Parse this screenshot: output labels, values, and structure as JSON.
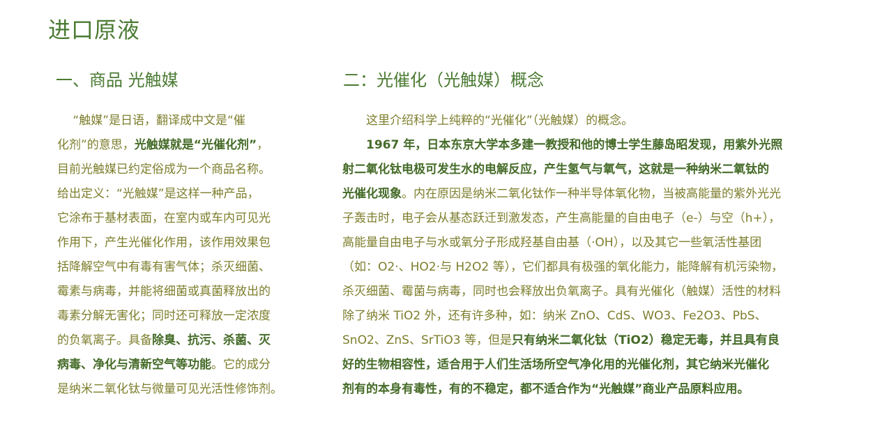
{
  "page_title": "进口原液",
  "section1": {
    "heading": "一、商品 光触媒",
    "lines": [
      [
        {
          "t": "　 “触媒”是日语，翻译成中文是“催"
        }
      ],
      [
        {
          "t": "化剂”的意思，"
        },
        {
          "t": "光触媒就是“光催化剂”",
          "b": true
        },
        {
          "t": "，"
        }
      ],
      [
        {
          "t": "目前光触媒已约定俗成为一个商品名称。"
        }
      ],
      [
        {
          "t": "给出定义：“光触媒”是这样一种产品，"
        }
      ],
      [
        {
          "t": "它涂布于基材表面，在室内或车内可见光"
        }
      ],
      [
        {
          "t": "作用下，产生光催化作用，该作用效果包"
        }
      ],
      [
        {
          "t": "括降解空气中有毒有害气体；杀灭细菌、"
        }
      ],
      [
        {
          "t": "霉素与病毒，并能将细菌或真菌释放出的"
        }
      ],
      [
        {
          "t": "毒素分解无害化；同时还可释放一定浓度"
        }
      ],
      [
        {
          "t": "的负氧离子。具备"
        },
        {
          "t": "除臭、抗污、杀菌、灭",
          "b": true
        }
      ],
      [
        {
          "t": "病毒、净化与清新空气等功能",
          "b": true
        },
        {
          "t": "。它的成分"
        }
      ],
      [
        {
          "t": "是纳米二氧化钛与微量可见光活性修饰剂。"
        }
      ]
    ]
  },
  "section2": {
    "heading": "二：光催化（光触媒）概念",
    "lines": [
      [
        {
          "t": "　　这里介绍科学上纯粹的“光催化”（光触媒）的概念。"
        }
      ],
      [
        {
          "t": "　　1967 年，日本东京大学本多建一教授和他的博士学生藤岛昭发现，用紫外光照",
          "b": true
        }
      ],
      [
        {
          "t": "射二氧化钛电极可发生水的电解反应，产生氢气与氧气，这就是一种纳米二氧钛的",
          "b": true
        }
      ],
      [
        {
          "t": "光催化现象",
          "b": true
        },
        {
          "t": "。内在原因是纳米二氧化钛作一种半导体氧化物，当被高能量的紫外光光"
        }
      ],
      [
        {
          "t": "子轰击时，电子会从基态跃迁到激发态，产生高能量的自由电子（e-）与空（h+），"
        }
      ],
      [
        {
          "t": "高能量自由电子与水或氧分子形成羟基自由基（·OH），以及其它一些氧活性基团"
        }
      ],
      [
        {
          "t": "（如：O2·、HO2·与 H2O2 等），它们都具有极强的氧化能力，能降解有机污染物，"
        }
      ],
      [
        {
          "t": "杀灭细菌、霉菌与病毒，同时也会释放出负氧离子。具有光催化（触媒）活性的材料"
        }
      ],
      [
        {
          "t": "除了纳米 TiO2 外，还有许多种，如：纳米 ZnO、CdS、WO3、Fe2O3、PbS、"
        }
      ],
      [
        {
          "t": "SnO2、ZnS、SrTiO3 等，但是"
        },
        {
          "t": "只有纳米二氧化钛（TiO2）稳定无毒，并且具有良",
          "b": true
        }
      ],
      [
        {
          "t": "好的生物相容性，适合用于人们生活场所空气净化用的光催化剂，其它纳米光催化",
          "b": true
        }
      ],
      [
        {
          "t": "剂有的本身有毒性，有的不稳定，都不适合作为“光触媒”商业产品原料应用。",
          "b": true
        }
      ]
    ]
  },
  "colors": {
    "heading": "#4a7a32",
    "body": "#7d7e2c",
    "bold": "#456b28"
  }
}
